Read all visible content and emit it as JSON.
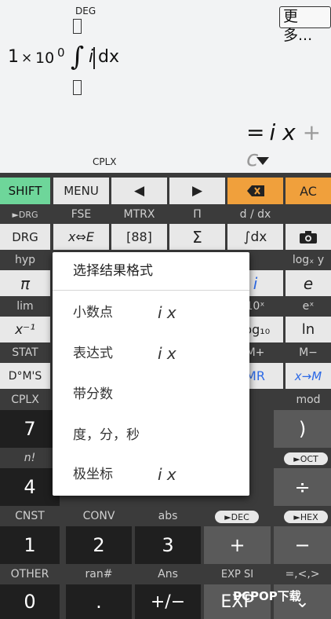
{
  "display": {
    "mode": "DEG",
    "more_button": "更多...",
    "expr": {
      "one": "1",
      "times": "×",
      "ten": "10",
      "exp": "0",
      "integral": "∫",
      "var": "i",
      "dx": "dx"
    },
    "result": {
      "eq": "=",
      "i": "i",
      "x": "x",
      "plus": "+",
      "c": "c"
    },
    "complex_indicator": "CPLX"
  },
  "keys": {
    "row1": {
      "shift": "SHIFT",
      "menu": "MENU",
      "left": "◀",
      "right": "▶",
      "backspace": "⌫",
      "ac": "AC"
    },
    "row1_labels": {
      "drg_small": "►DRG",
      "fse": "FSE",
      "mtrx": "MTRX",
      "pi_cap": "Π",
      "d_dx": "d / dx"
    },
    "row2": {
      "drg": "DRG",
      "x_e": "x⇔E",
      "matrix": "[88]",
      "sigma": "Σ",
      "integral": "∫dx",
      "camera": "camera"
    },
    "row2_labels": {
      "hyp": "hyp",
      "logx": "logₓ y"
    },
    "row3": {
      "pi": "π",
      "i": "i",
      "e": "e"
    },
    "row3_labels": {
      "lim": "lim",
      "ten_x": "10ˣ",
      "e_x": "eˣ"
    },
    "row4": {
      "x_inv": "x⁻¹",
      "log10": "log₁₀",
      "ln": "ln"
    },
    "row4_labels": {
      "stat": "STAT",
      "m_plus": "M+",
      "m_minus": "M−"
    },
    "row5": {
      "dms": "D°M'S",
      "mr": "MR",
      "x_to_m": "x→M"
    },
    "row5_labels": {
      "cplx": "CPLX",
      "mod": "mod"
    },
    "row6": {
      "seven": "7",
      "rparen": ")"
    },
    "row6_labels": {
      "nfact": "n!",
      "oct": "►OCT"
    },
    "row7": {
      "four": "4",
      "div": "÷"
    },
    "row7_labels": {
      "cnst": "CNST",
      "conv": "CONV",
      "abs": "abs",
      "dec": "►DEC",
      "hex": "►HEX"
    },
    "row8": {
      "one": "1",
      "two": "2",
      "three": "3",
      "plus": "+",
      "minus": "−"
    },
    "row8_labels": {
      "other": "OTHER",
      "ran": "ran#",
      "ans": "Ans",
      "exp_si": "EXP SI",
      "cmp": "=,<,>"
    },
    "row9": {
      "zero": "0",
      "dot": ".",
      "neg": "+/−",
      "exp": "EXP",
      "down": "⌄"
    }
  },
  "popup": {
    "title": "选择结果格式",
    "items": [
      {
        "label": "小数点",
        "value": "i x"
      },
      {
        "label": "表达式",
        "value": "i x"
      },
      {
        "label": "带分数",
        "value": ""
      },
      {
        "label": "度，分，秒",
        "value": ""
      },
      {
        "label": "极坐标",
        "value": "i x"
      }
    ]
  },
  "watermark": "PCPOP下载",
  "colors": {
    "shift_green": "#6ed69a",
    "orange": "#f0a03c",
    "blue_text": "#2d6ae6"
  }
}
